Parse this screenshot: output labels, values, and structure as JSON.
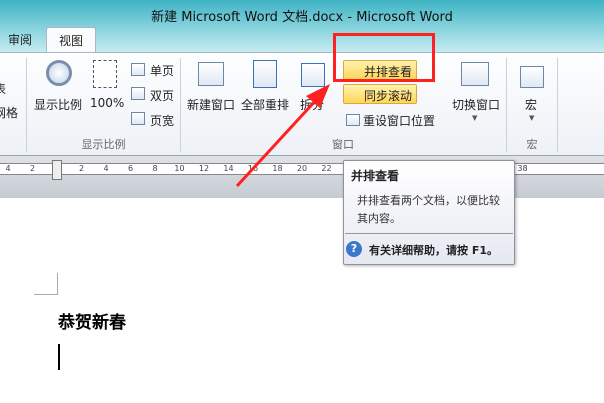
{
  "window": {
    "title": "新建 Microsoft Word 文档.docx  -  Microsoft Word"
  },
  "tabs": [
    {
      "label": "审阅"
    },
    {
      "label": "视图",
      "active": true
    }
  ],
  "ribbon": {
    "left_partial": [
      "表",
      "网格"
    ],
    "zoom_group": {
      "label": "显示比例",
      "zoom": "显示比例",
      "hundred": "100%",
      "one_page": "单页",
      "two_pages": "双页",
      "page_width": "页宽"
    },
    "window_group": {
      "label": "窗口",
      "new_window": "新建窗口",
      "arrange_all": "全部重排",
      "split": "拆分",
      "view_side_by_side": "并排查看",
      "sync_scroll": "同步滚动",
      "reset_position": "重设窗口位置",
      "switch_windows": "切换窗口"
    },
    "macro_group": {
      "label": "宏",
      "macros": "宏"
    }
  },
  "ruler": {
    "left": [
      "4",
      "2"
    ],
    "right": [
      "2",
      "4",
      "6",
      "8",
      "10",
      "12",
      "14",
      "16",
      "18",
      "20",
      "22",
      "24",
      "26",
      "28",
      "30",
      "32",
      "34",
      "36",
      "38"
    ]
  },
  "tooltip": {
    "title": "并排查看",
    "body": "并排查看两个文档，以便比较其内容。",
    "help": "有关详细帮助，请按 F1。"
  },
  "document": {
    "heading": "恭贺新春"
  },
  "annotation": {
    "color": "#ff2020"
  }
}
